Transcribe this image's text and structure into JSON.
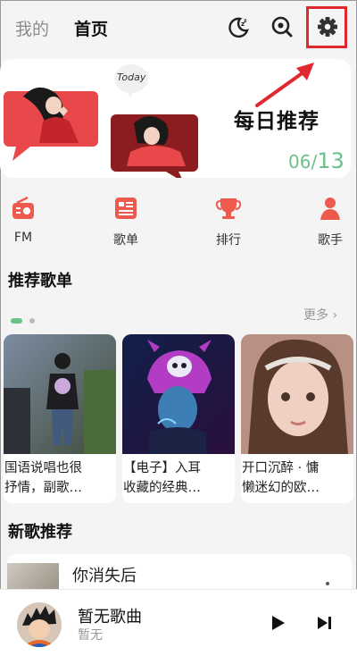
{
  "tabs": {
    "mine": "我的",
    "home": "首页"
  },
  "top_icons": [
    "moon-sleep-icon",
    "search-icon",
    "gear-icon"
  ],
  "banner": {
    "title": "每日推荐",
    "bubble_text": "Today",
    "current": "06",
    "separator": "/",
    "total": "13"
  },
  "nav": [
    {
      "label": "FM",
      "icon": "radio-icon"
    },
    {
      "label": "歌单",
      "icon": "playlist-icon"
    },
    {
      "label": "排行",
      "icon": "trophy-icon"
    },
    {
      "label": "歌手",
      "icon": "singer-icon"
    }
  ],
  "recommended": {
    "title": "推荐歌单",
    "more": "更多 ›",
    "cards": [
      {
        "line1": "国语说唱也很",
        "line2": "抒情，副歌…"
      },
      {
        "line1": "【电子】入耳",
        "line2": "收藏的经典…"
      },
      {
        "line1": "开口沉醉 · 慵",
        "line2": "懒迷幻的欧…"
      }
    ]
  },
  "new_songs": {
    "title": "新歌推荐",
    "first_song": "你消失后"
  },
  "player": {
    "title": "暂无歌曲",
    "subtitle": "暂无"
  },
  "colors": {
    "accent_red": "#ef5a4f",
    "count_green": "#6cc08a",
    "annotation_red": "#e0282f"
  }
}
